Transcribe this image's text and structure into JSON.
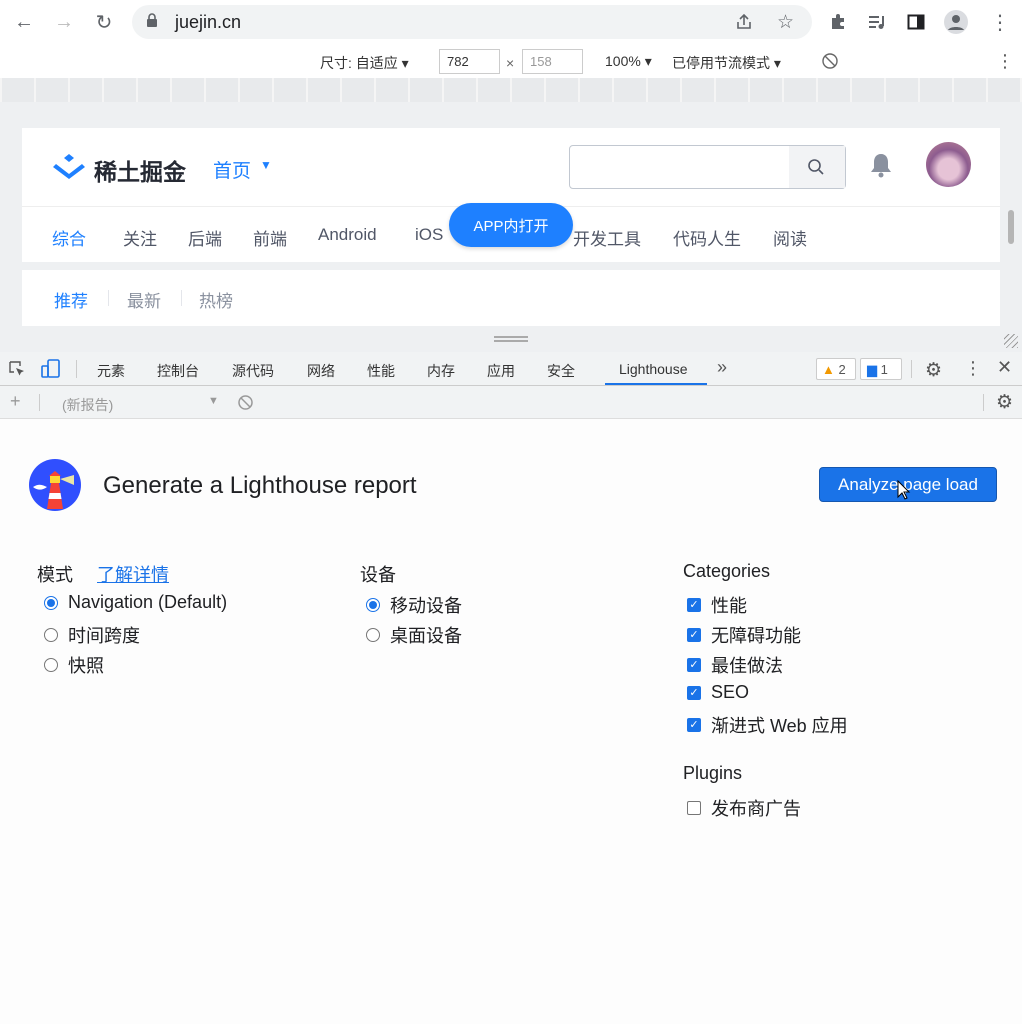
{
  "browser": {
    "url": "juejin.cn"
  },
  "device_toolbar": {
    "dimensions_label": "尺寸: 自适应 ▾",
    "width": "782",
    "times": "×",
    "height": "158",
    "zoom": "100% ▾",
    "throttle": "已停用节流模式 ▾"
  },
  "juejin": {
    "logo_text": "稀土掘金",
    "home_menu": "首页",
    "tabs": [
      "综合",
      "关注",
      "后端",
      "前端",
      "Android",
      "iOS",
      "开发工具",
      "代码人生",
      "阅读"
    ],
    "app_button": "APP内打开",
    "subtabs": [
      "推荐",
      "最新",
      "热榜"
    ]
  },
  "devtools": {
    "tabs": [
      "元素",
      "控制台",
      "源代码",
      "网络",
      "性能",
      "内存",
      "应用",
      "安全",
      "Lighthouse"
    ],
    "more": "»",
    "warnings": "2",
    "messages": "1",
    "report_select": "(新报告)"
  },
  "lighthouse": {
    "title": "Generate a Lighthouse report",
    "analyze_button": "Analyze page load",
    "mode": {
      "title": "模式",
      "learn_more": "了解详情",
      "options": [
        "Navigation (Default)",
        "时间跨度",
        "快照"
      ]
    },
    "device": {
      "title": "设备",
      "options": [
        "移动设备",
        "桌面设备"
      ]
    },
    "categories": {
      "title": "Categories",
      "options": [
        "性能",
        "无障碍功能",
        "最佳做法",
        "SEO",
        "渐进式 Web 应用"
      ]
    },
    "plugins": {
      "title": "Plugins",
      "options": [
        "发布商广告"
      ]
    }
  },
  "colors": {
    "accent": "#1a73e8",
    "juejin_blue": "#1e80ff"
  }
}
